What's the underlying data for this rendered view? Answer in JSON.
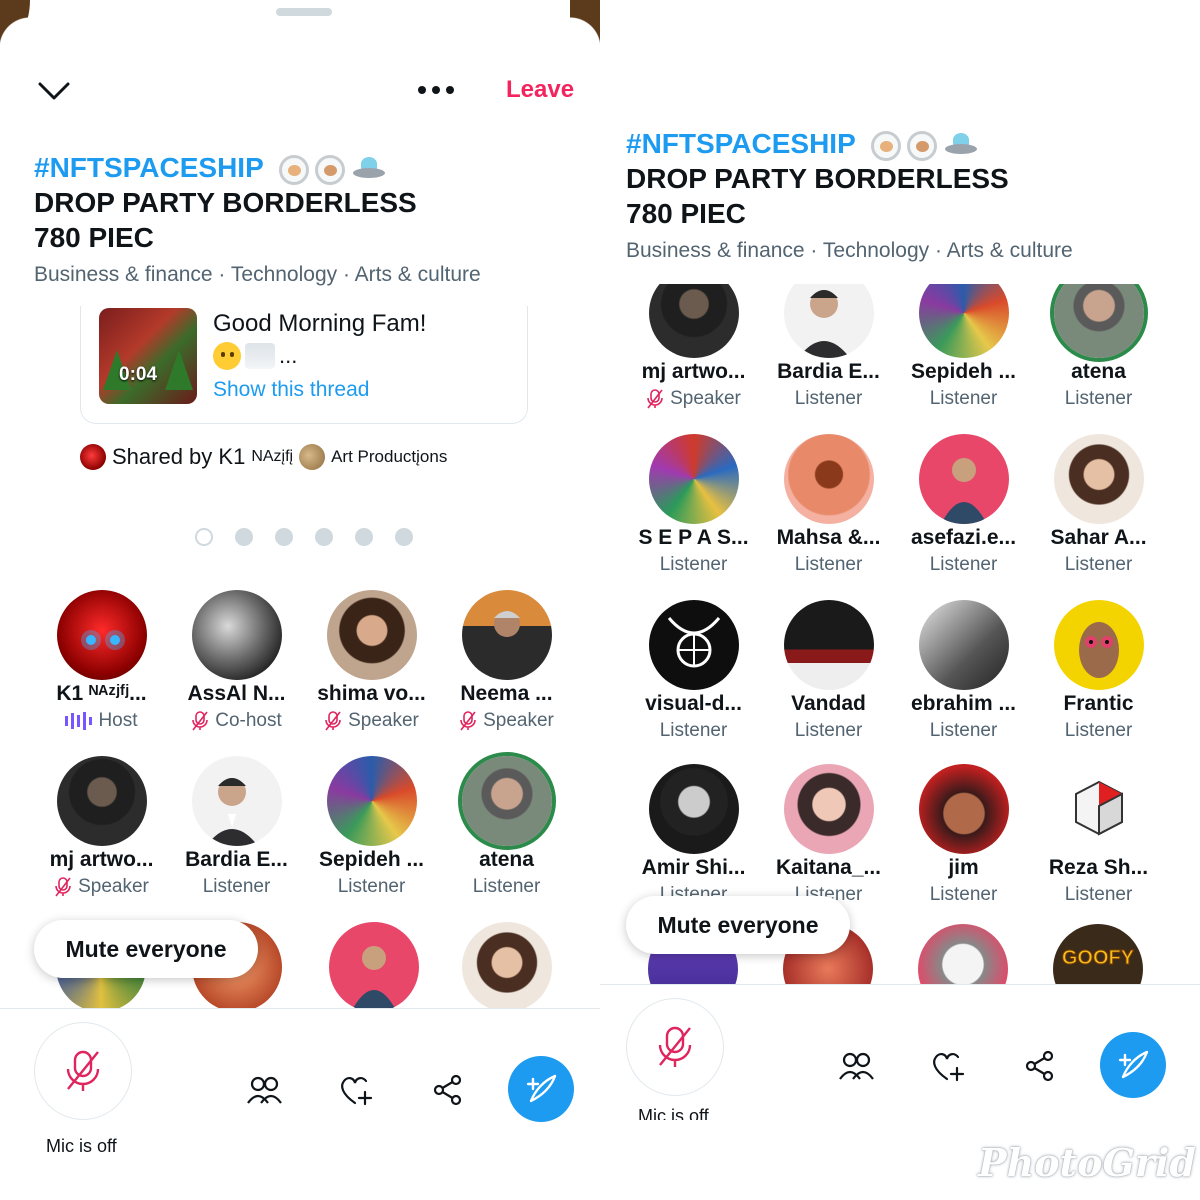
{
  "left": {
    "leave_label": "Leave",
    "title_hash": "#NFTSPACESHIP",
    "title_line2": "DROP PARTY BORDERLESS",
    "title_line3": "780 PIEC",
    "topics": "Business & finance · Technology · Arts & culture",
    "tweet": {
      "duration": "0:04",
      "text": "Good Morning Fam!",
      "ellipsis": "...",
      "show_thread": "Show this thread"
    },
    "shared_by_prefix": "Shared by K1",
    "shared_by_name_sup": "NAzįfį",
    "shared_by_suffix": "Art Productįons",
    "mic_label": "Mic is off",
    "mute_everyone": "Mute everyone",
    "participants": [
      {
        "name": "K1 ᴺᴬᶻʲᶠʲ...",
        "role": "Host"
      },
      {
        "name": "AssAl N...",
        "role": "Co-host"
      },
      {
        "name": "shima vo...",
        "role": "Speaker"
      },
      {
        "name": "Neema ...",
        "role": "Speaker"
      },
      {
        "name": "mj artwo...",
        "role": "Speaker"
      },
      {
        "name": "Bardia E...",
        "role": "Listener"
      },
      {
        "name": "Sepideh ...",
        "role": "Listener"
      },
      {
        "name": "atena",
        "role": "Listener"
      }
    ]
  },
  "right": {
    "title_hash": "#NFTSPACESHIP",
    "title_line2": "DROP PARTY BORDERLESS",
    "title_line3": "780 PIEC",
    "topics": "Business & finance · Technology · Arts & culture",
    "mic_label": "Mic is off",
    "mute_everyone": "Mute everyone",
    "participants": [
      {
        "name": "mj artwo...",
        "role": "Speaker"
      },
      {
        "name": "Bardia E...",
        "role": "Listener"
      },
      {
        "name": "Sepideh ...",
        "role": "Listener"
      },
      {
        "name": "atena",
        "role": "Listener"
      },
      {
        "name": "S E P A S...",
        "role": "Listener"
      },
      {
        "name": "Mahsa &...",
        "role": "Listener"
      },
      {
        "name": "asefazi.e...",
        "role": "Listener"
      },
      {
        "name": "Sahar A...",
        "role": "Listener"
      },
      {
        "name": "visual-d...",
        "role": "Listener"
      },
      {
        "name": "Vandad",
        "role": "Listener"
      },
      {
        "name": "ebrahim ...",
        "role": "Listener"
      },
      {
        "name": "Frantic",
        "role": "Listener"
      },
      {
        "name": "Amir Shi...",
        "role": "Listener"
      },
      {
        "name": "Kaitana_...",
        "role": "Listener"
      },
      {
        "name": "jim",
        "role": "Listener"
      },
      {
        "name": "Reza Sh...",
        "role": "Listener"
      }
    ],
    "goofy_text": "GOOFY"
  },
  "icons": [
    "chevron-down-icon",
    "more-icon",
    "mic-off-icon",
    "people-icon",
    "heart-plus-icon",
    "share-icon",
    "compose-icon"
  ],
  "colors": {
    "accent": "#1d9bf0",
    "leave": "#f4245e",
    "host": "#7856ff",
    "mic_off": "#e0245e",
    "muted_text": "#536471"
  },
  "watermark": "PhotoGrid"
}
